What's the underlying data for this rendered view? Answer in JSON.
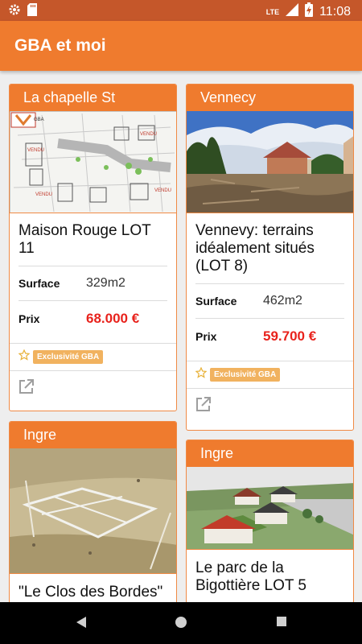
{
  "status_bar": {
    "time": "11:08",
    "network": "LTE",
    "icons": [
      "gear-icon",
      "sd-card-icon",
      "signal-icon",
      "battery-icon"
    ]
  },
  "app_bar": {
    "title": "GBA et moi"
  },
  "listings": [
    {
      "city": "La chapelle St",
      "title": "Maison Rouge LOT 11",
      "surface_label": "Surface",
      "surface": "329m2",
      "price_label": "Prix",
      "price": "68.000 €",
      "badge": "Exclusivité GBA"
    },
    {
      "city": "Vennecy",
      "title": "Vennevy: terrains idéalement situés (LOT 8)",
      "surface_label": "Surface",
      "surface": "462m2",
      "price_label": "Prix",
      "price": "59.700 €",
      "badge": "Exclusivité GBA"
    },
    {
      "city": "Ingre",
      "title": "\"Le Clos des Bordes\""
    },
    {
      "city": "Ingre",
      "title": "Le parc de la Bigottière LOT 5"
    }
  ],
  "plan_labels": [
    "VENDU",
    "VENDU",
    "VENDU",
    "VENDU"
  ],
  "colors": {
    "accent": "#ef7b2e",
    "status_bar": "#c5572a",
    "price": "#e8221c",
    "badge": "#f1b25f"
  },
  "nav_bar": {
    "icons": [
      "back-icon",
      "home-icon",
      "recents-icon"
    ]
  }
}
